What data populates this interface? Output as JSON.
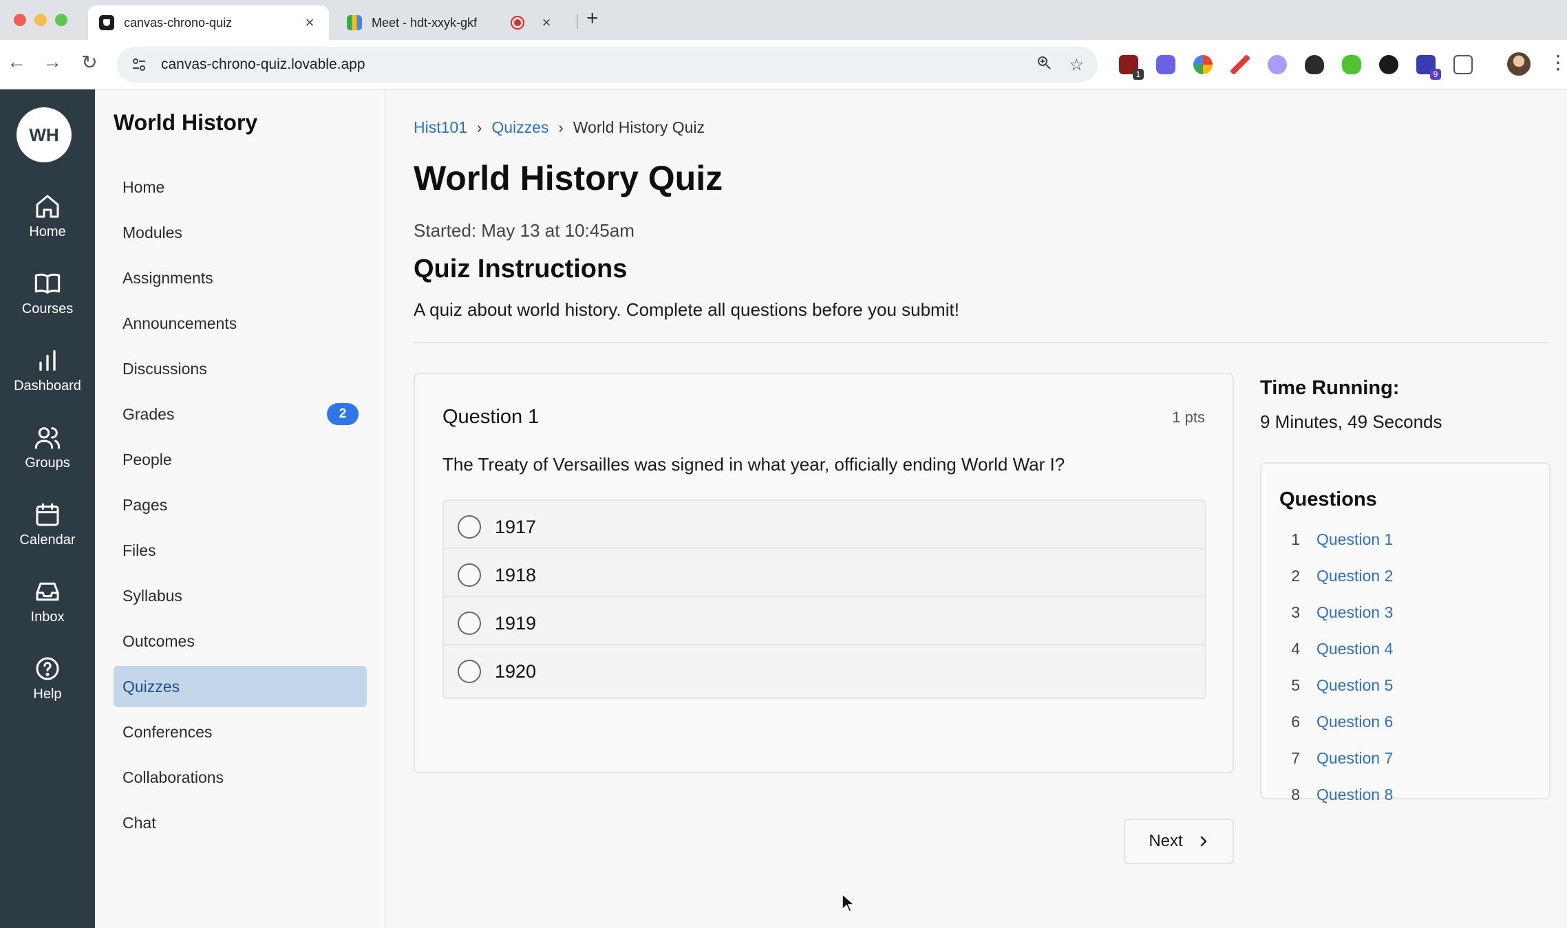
{
  "browser": {
    "tabs": [
      {
        "title": "canvas-chrono-quiz",
        "active": true
      },
      {
        "title": "Meet - hdt-xxyk-gkf",
        "active": false,
        "recording": true
      }
    ],
    "url": "canvas-chrono-quiz.lovable.app",
    "extension_badges": [
      "1",
      "9"
    ]
  },
  "global_nav": {
    "avatar_initials": "WH",
    "items": [
      {
        "label": "Home",
        "icon": "home-icon"
      },
      {
        "label": "Courses",
        "icon": "book-icon"
      },
      {
        "label": "Dashboard",
        "icon": "bar-chart-icon"
      },
      {
        "label": "Groups",
        "icon": "users-icon"
      },
      {
        "label": "Calendar",
        "icon": "calendar-icon"
      },
      {
        "label": "Inbox",
        "icon": "inbox-icon"
      },
      {
        "label": "Help",
        "icon": "help-circle-icon"
      }
    ]
  },
  "course_nav": {
    "title": "World History",
    "items": [
      {
        "label": "Home"
      },
      {
        "label": "Modules"
      },
      {
        "label": "Assignments"
      },
      {
        "label": "Announcements"
      },
      {
        "label": "Discussions"
      },
      {
        "label": "Grades",
        "badge": "2"
      },
      {
        "label": "People"
      },
      {
        "label": "Pages"
      },
      {
        "label": "Files"
      },
      {
        "label": "Syllabus"
      },
      {
        "label": "Outcomes"
      },
      {
        "label": "Quizzes",
        "active": true
      },
      {
        "label": "Conferences"
      },
      {
        "label": "Collaborations"
      },
      {
        "label": "Chat"
      }
    ]
  },
  "breadcrumb": {
    "course": "Hist101",
    "section": "Quizzes",
    "current": "World History Quiz",
    "separator": "›"
  },
  "quiz": {
    "title": "World History Quiz",
    "started": "Started: May 13 at 10:45am",
    "instructions_title": "Quiz Instructions",
    "instructions": "A quiz about world history. Complete all questions before you submit!",
    "question": {
      "number_label": "Question 1",
      "points": "1 pts",
      "text": "The Treaty of Versailles was signed in what year, officially ending World War I?",
      "options": [
        "1917",
        "1918",
        "1919",
        "1920"
      ]
    },
    "next_label": "Next"
  },
  "sidebar": {
    "timer_label": "Time Running:",
    "timer_value": "9 Minutes, 49 Seconds",
    "questions_title": "Questions",
    "questions": [
      {
        "n": "1",
        "label": "Question 1"
      },
      {
        "n": "2",
        "label": "Question 2"
      },
      {
        "n": "3",
        "label": "Question 3"
      },
      {
        "n": "4",
        "label": "Question 4"
      },
      {
        "n": "5",
        "label": "Question 5"
      },
      {
        "n": "6",
        "label": "Question 6"
      },
      {
        "n": "7",
        "label": "Question 7"
      },
      {
        "n": "8",
        "label": "Question 8"
      }
    ]
  },
  "colors": {
    "global_nav_bg": "#2d3b45",
    "link": "#2d6fc2",
    "active_nav_bg": "#c4d6ea",
    "badge": "#2f76ea"
  }
}
